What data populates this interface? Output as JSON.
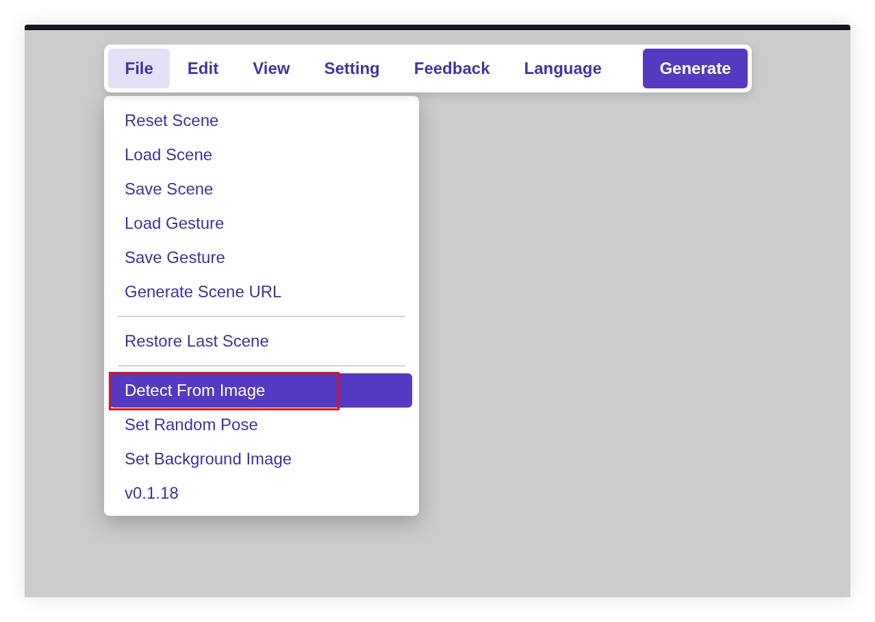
{
  "menubar": [
    {
      "label": "File",
      "kind": "menu",
      "selected": true
    },
    {
      "label": "Edit",
      "kind": "menu",
      "selected": false
    },
    {
      "label": "View",
      "kind": "menu",
      "selected": false
    },
    {
      "label": "Setting",
      "kind": "menu",
      "selected": false
    },
    {
      "label": "Feedback",
      "kind": "menu",
      "selected": false
    },
    {
      "label": "Language",
      "kind": "menu",
      "selected": false
    },
    {
      "label": "Generate",
      "kind": "button"
    }
  ],
  "file_menu": {
    "sections": [
      {
        "items": [
          {
            "label": "Reset Scene",
            "selected": false,
            "annotated": false
          },
          {
            "label": "Load Scene",
            "selected": false,
            "annotated": false
          },
          {
            "label": "Save Scene",
            "selected": false,
            "annotated": false
          },
          {
            "label": "Load Gesture",
            "selected": false,
            "annotated": false
          },
          {
            "label": "Save Gesture",
            "selected": false,
            "annotated": false
          },
          {
            "label": "Generate Scene URL",
            "selected": false,
            "annotated": false
          }
        ]
      },
      {
        "items": [
          {
            "label": "Restore Last Scene",
            "selected": false,
            "annotated": false
          }
        ]
      },
      {
        "items": [
          {
            "label": "Detect From Image",
            "selected": true,
            "annotated": true
          },
          {
            "label": "Set Random Pose",
            "selected": false,
            "annotated": false
          },
          {
            "label": "Set Background Image",
            "selected": false,
            "annotated": false
          },
          {
            "label": "v0.1.18",
            "selected": false,
            "annotated": false
          }
        ]
      }
    ]
  }
}
